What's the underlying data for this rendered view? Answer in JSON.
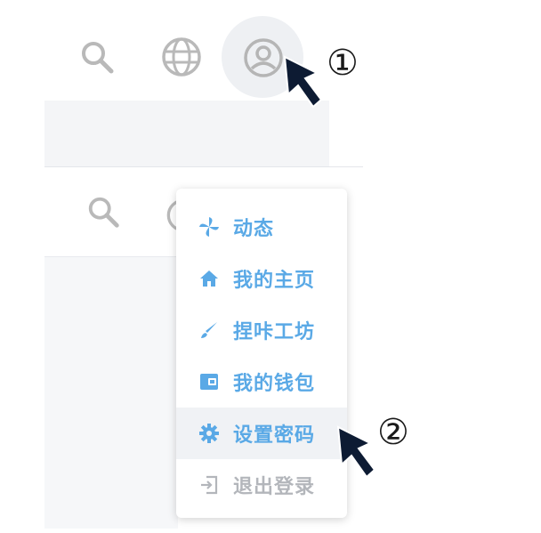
{
  "colors": {
    "menu_text": "#5aa9e6",
    "disabled_text": "#b3b6bb",
    "header_icon": "#b9b9b9",
    "cursor": "#0d1b33"
  },
  "header": {
    "icons": [
      "search-icon",
      "globe-icon",
      "user-avatar-icon"
    ],
    "second_row_icons": [
      "search-icon"
    ]
  },
  "menu": {
    "items": [
      {
        "label": "动态",
        "icon": "pinwheel-icon"
      },
      {
        "label": "我的主页",
        "icon": "home-icon"
      },
      {
        "label": "捏咔工坊",
        "icon": "brush-icon"
      },
      {
        "label": "我的钱包",
        "icon": "wallet-icon"
      },
      {
        "label": "设置密码",
        "icon": "gear-icon"
      },
      {
        "label": "退出登录",
        "icon": "logout-icon"
      }
    ]
  },
  "annotations": {
    "step1": "①",
    "step2": "②"
  }
}
